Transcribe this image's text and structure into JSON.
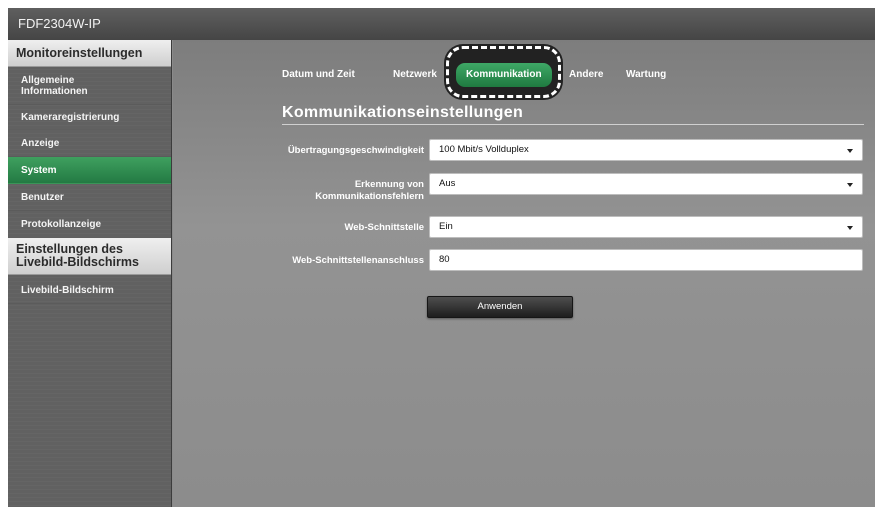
{
  "window": {
    "title": "FDF2304W-IP"
  },
  "sidebar": {
    "section1": "Monitoreinstellungen",
    "items": [
      {
        "label": "Allgemeine\nInformationen"
      },
      {
        "label": "Kameraregistrierung"
      },
      {
        "label": "Anzeige"
      },
      {
        "label": "System"
      },
      {
        "label": "Benutzer"
      },
      {
        "label": "Protokollanzeige"
      }
    ],
    "section2": "Einstellungen des Livebild-Bildschirms",
    "items2": [
      {
        "label": "Livebild-Bildschirm"
      }
    ],
    "active_item": "System"
  },
  "tabs": [
    {
      "label": "Datum und Zeit"
    },
    {
      "label": "Netzwerk"
    },
    {
      "label": "Kommunikation"
    },
    {
      "label": "Andere"
    },
    {
      "label": "Wartung"
    }
  ],
  "active_tab": "Kommunikation",
  "section_title": "Kommunikationseinstellungen",
  "form": {
    "speed_label": "Übertragungsgeschwindigkeit",
    "speed_value": "100 Mbit/s Vollduplex",
    "error_label": "Erkennung von Kommunikationsfehlern",
    "error_value": "Aus",
    "web_label": "Web-Schnittstelle",
    "web_value": "Ein",
    "port_label": "Web-Schnittstellenanschluss",
    "port_value": "80"
  },
  "apply_label": "Anwenden",
  "colors": {
    "accent_green": "#2e8f50",
    "titlebar": "#505050"
  }
}
